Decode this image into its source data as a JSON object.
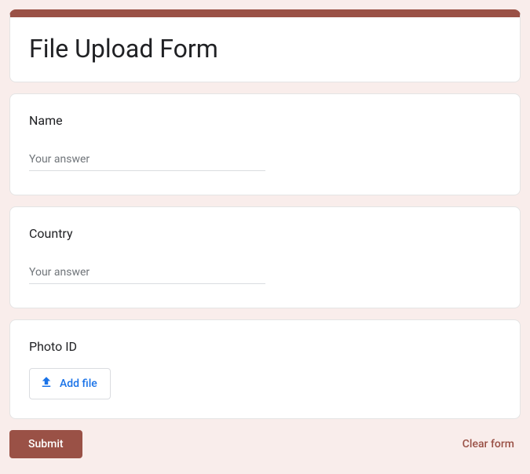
{
  "form": {
    "title": "File Upload Form"
  },
  "questions": {
    "name": {
      "label": "Name",
      "placeholder": "Your answer"
    },
    "country": {
      "label": "Country",
      "placeholder": "Your answer"
    },
    "photo_id": {
      "label": "Photo ID",
      "add_file_label": "Add file"
    }
  },
  "footer": {
    "submit_label": "Submit",
    "clear_label": "Clear form"
  }
}
